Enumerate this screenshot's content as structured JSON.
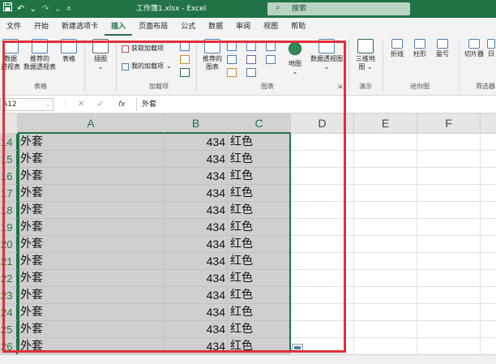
{
  "titlebar": {
    "save_icon": "save-icon",
    "undo_glyph": "↶",
    "undo_dropdown": "⌄",
    "redo_glyph": "↷",
    "redo_dropdown": "⌄",
    "customize_glyph": "⩡",
    "doc_title": "工作簿1.xlsx  -  Excel",
    "search_placeholder": "搜索",
    "search_glyph": "⌕",
    "bar_color": "#217346"
  },
  "tabs": [
    {
      "label": "文件",
      "active": false
    },
    {
      "label": "开始",
      "active": false
    },
    {
      "label": "新建选项卡",
      "active": false
    },
    {
      "label": "插入",
      "active": true
    },
    {
      "label": "页面布局",
      "active": false
    },
    {
      "label": "公式",
      "active": false
    },
    {
      "label": "数据",
      "active": false
    },
    {
      "label": "审阅",
      "active": false
    },
    {
      "label": "视图",
      "active": false
    },
    {
      "label": "帮助",
      "active": false
    }
  ],
  "ribbon": {
    "tables": {
      "pivot_line1": "数据",
      "pivot_line2": "透视表",
      "rec_pivot_line1": "推荐的",
      "rec_pivot_line2": "数据透视表",
      "table": "表格",
      "group_label": "表格"
    },
    "illustrations": {
      "label": "插图",
      "dropdown": "⌄"
    },
    "addins": {
      "get_addins": "获取加载项",
      "my_addins": "我的加载项",
      "my_addins_dropdown": "⌄",
      "group_label": "加载项"
    },
    "charts": {
      "rec_charts_line1": "推荐的",
      "rec_charts_line2": "图表",
      "map": "地图",
      "map_dropdown": "⌄",
      "pivot_chart": "数据透视图",
      "pivot_chart_dropdown": "⌄",
      "group_label": "图表",
      "launcher": "⇲"
    },
    "tours": {
      "map3d_line1": "三维地",
      "map3d_line2": "图",
      "map3d_dropdown": "⌄",
      "group_label": "演示"
    },
    "sparklines": {
      "line": "折线",
      "column": "柱形",
      "winloss": "盈亏",
      "group_label": "迷你图"
    },
    "filters": {
      "slicer": "切片器",
      "timeline": "日",
      "group_label": "筛选器"
    }
  },
  "formula_bar": {
    "name_box": "A12",
    "name_box_dropdown": "⌄",
    "cancel_glyph": "✕",
    "enter_glyph": "✓",
    "fx_label": "fx",
    "separator": "⋮",
    "value": "外套"
  },
  "columns": [
    {
      "label": "A",
      "selected": true
    },
    {
      "label": "B",
      "selected": true
    },
    {
      "label": "C",
      "selected": true
    },
    {
      "label": "D",
      "selected": false
    },
    {
      "label": "E",
      "selected": false
    },
    {
      "label": "F",
      "selected": false
    }
  ],
  "rows": [
    {
      "num": "14",
      "a": "外套",
      "b": "434",
      "c": "红色"
    },
    {
      "num": "15",
      "a": "外套",
      "b": "434",
      "c": "红色"
    },
    {
      "num": "16",
      "a": "外套",
      "b": "434",
      "c": "红色"
    },
    {
      "num": "17",
      "a": "外套",
      "b": "434",
      "c": "红色"
    },
    {
      "num": "18",
      "a": "外套",
      "b": "434",
      "c": "红色"
    },
    {
      "num": "19",
      "a": "外套",
      "b": "434",
      "c": "红色"
    },
    {
      "num": "20",
      "a": "外套",
      "b": "434",
      "c": "红色"
    },
    {
      "num": "21",
      "a": "外套",
      "b": "434",
      "c": "红色"
    },
    {
      "num": "22",
      "a": "外套",
      "b": "434",
      "c": "红色"
    },
    {
      "num": "23",
      "a": "外套",
      "b": "434",
      "c": "红色"
    },
    {
      "num": "24",
      "a": "外套",
      "b": "434",
      "c": "红色"
    },
    {
      "num": "25",
      "a": "外套",
      "b": "434",
      "c": "红色"
    },
    {
      "num": "26",
      "a": "外套",
      "b": "434",
      "c": "红色"
    }
  ],
  "colors": {
    "accent": "#217346",
    "selection_fill": "#cfcfcf",
    "annotation_red": "#e0303a"
  }
}
